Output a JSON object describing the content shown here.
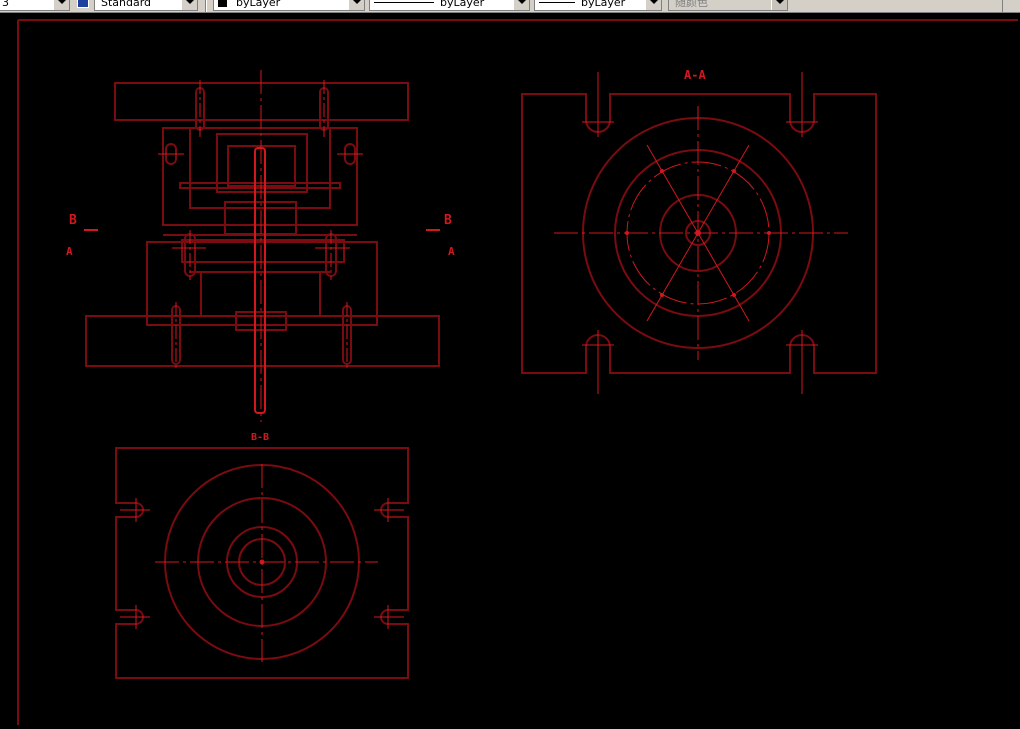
{
  "toolbar": {
    "layer_combo_text": "3",
    "text_style": "Standard",
    "color": "byLayer",
    "linetype": "byLayer",
    "lineweight": "byLayer",
    "plot_style": "随颜色"
  },
  "drawing": {
    "section_aa_label": "A-A",
    "section_bb_label": "B-B",
    "cut_b": "B",
    "cut_a": "A"
  },
  "colors": {
    "drawing_line": "#7a0b10",
    "center_line": "#d0181e",
    "background": "#000000"
  }
}
